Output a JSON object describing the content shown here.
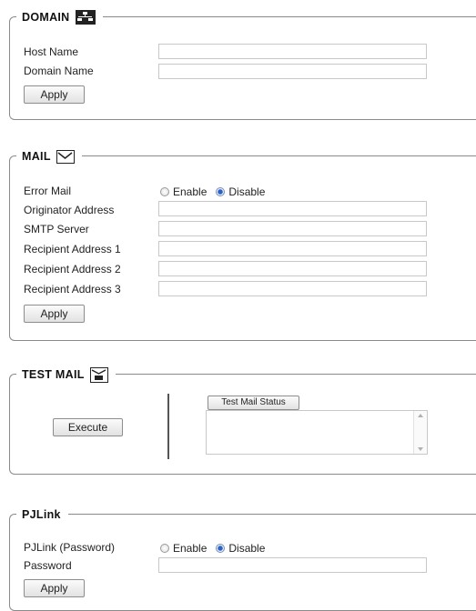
{
  "domain": {
    "title": "DOMAIN",
    "icon": "network-icon",
    "host_name_label": "Host Name",
    "host_name_value": "",
    "domain_name_label": "Domain Name",
    "domain_name_value": "",
    "apply_label": "Apply"
  },
  "mail": {
    "title": "MAIL",
    "icon": "envelope-icon",
    "error_mail_label": "Error Mail",
    "enable_label": "Enable",
    "disable_label": "Disable",
    "error_mail_selected": "Disable",
    "originator_label": "Originator Address",
    "originator_value": "",
    "smtp_label": "SMTP Server",
    "smtp_value": "",
    "recipient1_label": "Recipient Address 1",
    "recipient1_value": "",
    "recipient2_label": "Recipient Address 2",
    "recipient2_value": "",
    "recipient3_label": "Recipient Address 3",
    "recipient3_value": "",
    "apply_label": "Apply"
  },
  "test_mail": {
    "title": "TEST MAIL",
    "icon": "test-envelope-icon",
    "execute_label": "Execute",
    "status_button_label": "Test Mail Status",
    "status_text": ""
  },
  "pjlink": {
    "title": "PJLink",
    "pjlink_password_label": "PJLink (Password)",
    "enable_label": "Enable",
    "disable_label": "Disable",
    "selected": "Disable",
    "password_label": "Password",
    "password_value": "",
    "apply_label": "Apply"
  }
}
